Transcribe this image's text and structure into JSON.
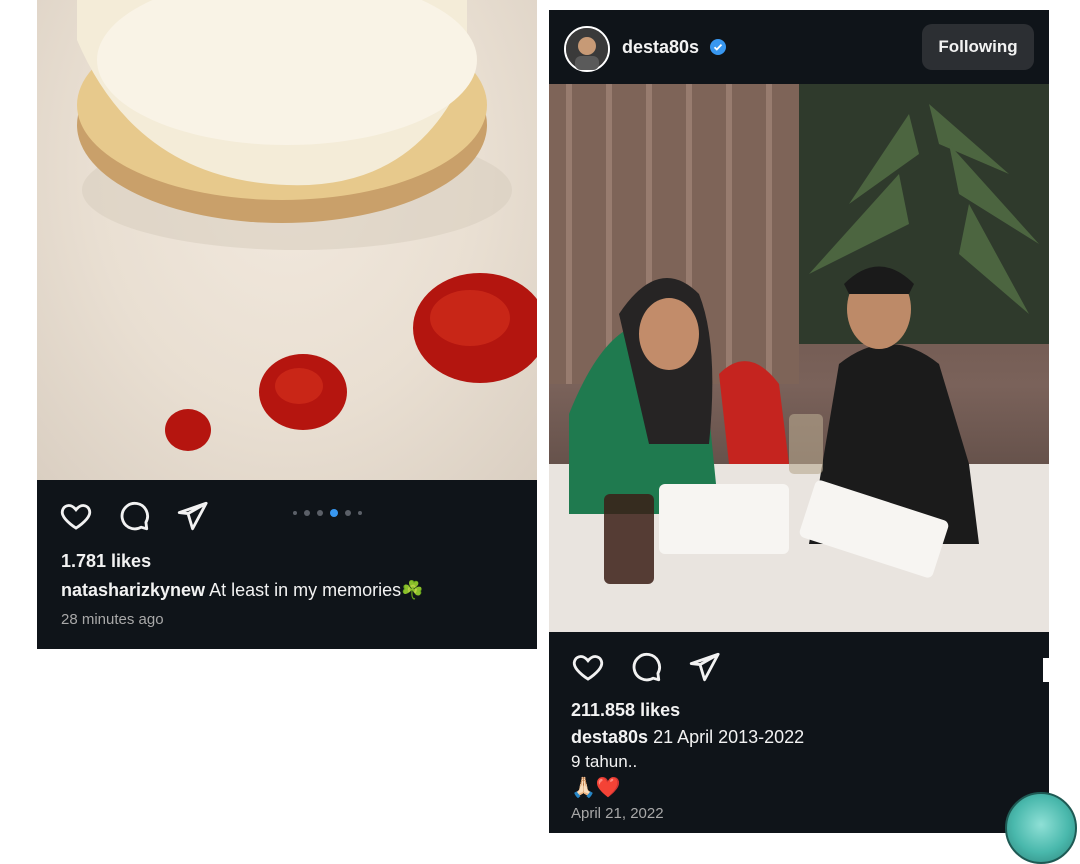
{
  "posts": {
    "left": {
      "likes": "1.781 likes",
      "username": "natasharizkynew",
      "caption": "At least in my memories☘️",
      "time": "28 minutes ago",
      "carousel_dots": 6,
      "carousel_active_index": 3
    },
    "right": {
      "header_username": "desta80s",
      "verified": true,
      "follow_label": "Following",
      "likes": "211.858 likes",
      "caption_username": "desta80s",
      "caption": "21 April 2013-2022",
      "caption_line2": "9 tahun..",
      "caption_line3": "🙏🏻❤️",
      "time": "April 21, 2022"
    }
  },
  "icons": {
    "like": "heart-icon",
    "comment": "comment-icon",
    "share": "send-icon",
    "verified": "verified-badge-icon",
    "tag": "user-tag-icon"
  },
  "colors": {
    "card_bg": "#0f1419",
    "text": "#f2f2f2",
    "muted": "#a8a8a8",
    "accent": "#3897f0",
    "follow_btn": "#2c2f33"
  }
}
